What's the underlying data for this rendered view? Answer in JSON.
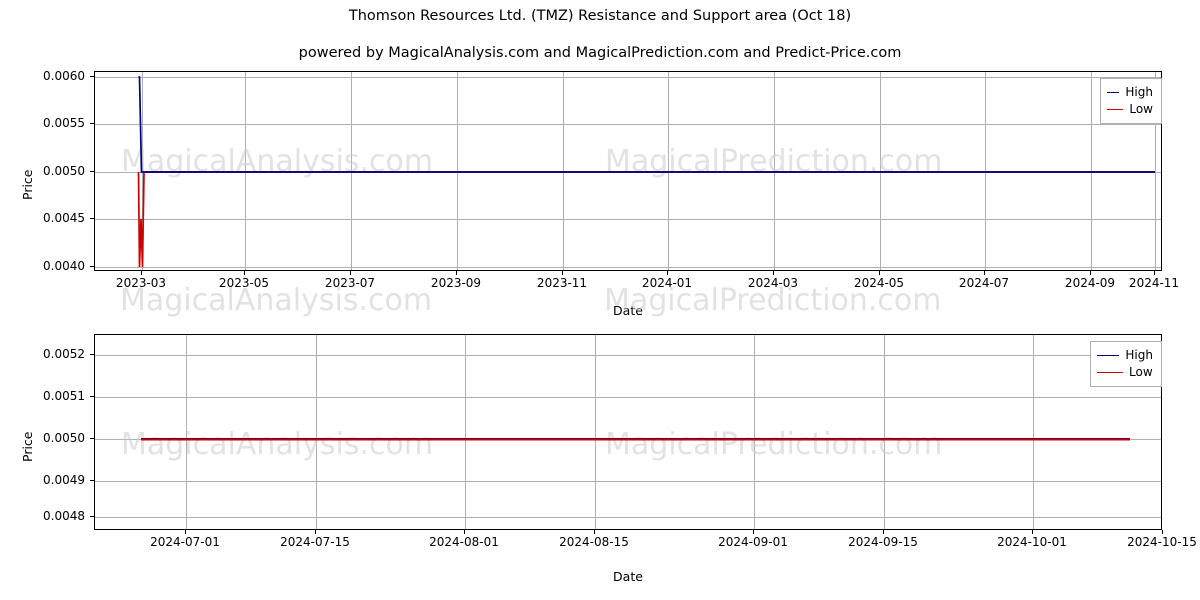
{
  "title": "Thomson Resources Ltd. (TMZ) Resistance and Support area (Oct 18)",
  "subtitle": "powered by MagicalAnalysis.com and MagicalPrediction.com and Predict-Price.com",
  "watermarks": [
    "MagicalAnalysis.com",
    "MagicalPrediction.com",
    "MagicalAnalysis.com",
    "MagicalPrediction.com",
    "MagicalAnalysis.com",
    "MagicalPrediction.com"
  ],
  "colors": {
    "high": "#00007f",
    "low": "#cc0000",
    "grid": "#b0b0b0",
    "axis": "#000000",
    "watermark": "#cccccc"
  },
  "chart_data": [
    {
      "type": "line",
      "title": "Thomson Resources Ltd. (TMZ) Resistance and Support area (Oct 18)",
      "xlabel": "Date",
      "ylabel": "Price",
      "xlim": [
        "2023-01-20",
        "2024-11-10"
      ],
      "ylim": [
        0.00395,
        0.00605
      ],
      "grid": true,
      "legend_position": "upper right",
      "xticks": [
        "2023-03",
        "2023-05",
        "2023-07",
        "2023-09",
        "2023-11",
        "2024-01",
        "2024-03",
        "2024-05",
        "2024-07",
        "2024-09",
        "2024-11"
      ],
      "yticks": [
        "0.0040",
        "0.0045",
        "0.0050",
        "0.0055",
        "0.0060"
      ],
      "series": [
        {
          "name": "High",
          "color": "#00007f",
          "x": [
            "2023-02-22",
            "2023-02-24",
            "2023-02-27",
            "2023-03-01",
            "2024-10-10"
          ],
          "values": [
            0.006,
            0.006,
            0.005,
            0.005,
            0.005
          ]
        },
        {
          "name": "Low",
          "color": "#cc0000",
          "x": [
            "2023-02-22",
            "2023-02-24",
            "2023-02-27",
            "2023-03-01",
            "2023-03-03",
            "2023-03-06",
            "2024-10-10"
          ],
          "values": [
            0.005,
            0.004,
            0.0045,
            0.004,
            0.005,
            0.005,
            0.005
          ]
        }
      ]
    },
    {
      "type": "line",
      "xlabel": "Date",
      "ylabel": "Price",
      "xlim": [
        "2024-06-18",
        "2024-10-22"
      ],
      "ylim": [
        0.00475,
        0.00528
      ],
      "grid": true,
      "legend_position": "upper right",
      "xticks": [
        "2024-07-01",
        "2024-07-15",
        "2024-08-01",
        "2024-08-15",
        "2024-09-01",
        "2024-09-15",
        "2024-10-01",
        "2024-10-15"
      ],
      "yticks": [
        "0.0048",
        "0.0049",
        "0.0050",
        "0.0051",
        "0.0052"
      ],
      "series": [
        {
          "name": "High",
          "color": "#00007f",
          "x": [
            "2024-06-24",
            "2024-10-16"
          ],
          "values": [
            0.005,
            0.005
          ]
        },
        {
          "name": "Low",
          "color": "#cc0000",
          "x": [
            "2024-06-24",
            "2024-10-16"
          ],
          "values": [
            0.005,
            0.005
          ]
        }
      ]
    }
  ],
  "top_chart": {
    "ylabel": "Price",
    "xlabel": "Date",
    "legend": [
      {
        "label": "High",
        "color": "#00007f"
      },
      {
        "label": "Low",
        "color": "#cc0000"
      }
    ],
    "yticks": [
      "0.0040",
      "0.0045",
      "0.0050",
      "0.0055",
      "0.0060"
    ],
    "xticks": [
      "2023-03",
      "2023-05",
      "2023-07",
      "2023-09",
      "2023-11",
      "2024-01",
      "2024-03",
      "2024-05",
      "2024-07",
      "2024-09",
      "2024-11"
    ]
  },
  "bottom_chart": {
    "ylabel": "Price",
    "xlabel": "Date",
    "legend": [
      {
        "label": "High",
        "color": "#00007f"
      },
      {
        "label": "Low",
        "color": "#cc0000"
      }
    ],
    "yticks": [
      "0.0048",
      "0.0049",
      "0.0050",
      "0.0051",
      "0.0052"
    ],
    "xticks": [
      "2024-07-01",
      "2024-07-15",
      "2024-08-01",
      "2024-08-15",
      "2024-09-01",
      "2024-09-15",
      "2024-10-01",
      "2024-10-15"
    ]
  }
}
